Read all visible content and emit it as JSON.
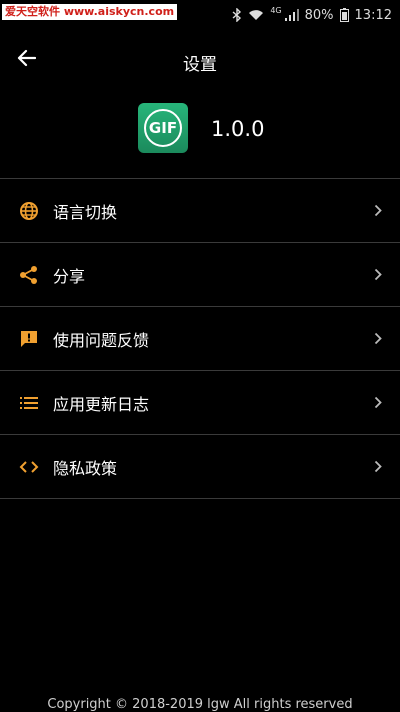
{
  "status_bar": {
    "watermark": "爱天空软件 www.aiskycn.com",
    "network_label": "4G",
    "battery": "80%",
    "time": "13:12"
  },
  "app_bar": {
    "title": "设置",
    "back_icon": "arrow-left-icon"
  },
  "app_info": {
    "icon_text": "GIF",
    "version": "1.0.0"
  },
  "menu": {
    "items": [
      {
        "label": "语言切换",
        "icon": "globe-icon"
      },
      {
        "label": "分享",
        "icon": "share-icon"
      },
      {
        "label": "使用问题反馈",
        "icon": "feedback-icon"
      },
      {
        "label": "应用更新日志",
        "icon": "list-icon"
      },
      {
        "label": "隐私政策",
        "icon": "code-icon"
      }
    ]
  },
  "footer": {
    "copyright": "Copyright © 2018-2019 lgw All rights reserved"
  },
  "colors": {
    "background": "#000000",
    "accent": "#f0a030",
    "divider": "#3a3a3a"
  }
}
